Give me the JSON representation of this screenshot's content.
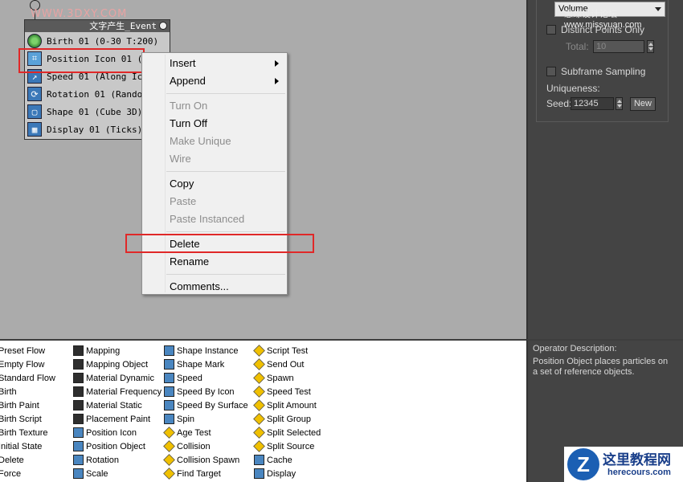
{
  "watermark_top": "WWW.3DXY.COM",
  "event": {
    "title": "文字产生_Event",
    "operators": [
      {
        "label": "Birth 01 (0-30 T:200)",
        "icon": "birth-icon"
      },
      {
        "label": "Position Icon 01 (Vo",
        "icon": "position-icon-icon"
      },
      {
        "label": "Speed 01 (Along Icon",
        "icon": "speed-icon"
      },
      {
        "label": "Rotation 01 (Random",
        "icon": "rotation-icon"
      },
      {
        "label": "Shape 01 (Cube 3D)",
        "icon": "shape-icon"
      },
      {
        "label": "Display 01 (Ticks)",
        "icon": "display-icon"
      }
    ]
  },
  "context_menu": {
    "groups": [
      [
        {
          "label": "Insert",
          "disabled": false,
          "submenu": true
        },
        {
          "label": "Append",
          "disabled": false,
          "submenu": true
        }
      ],
      [
        {
          "label": "Turn On",
          "disabled": true
        },
        {
          "label": "Turn Off",
          "disabled": false
        },
        {
          "label": "Make Unique",
          "disabled": true
        },
        {
          "label": "Wire",
          "disabled": true
        }
      ],
      [
        {
          "label": "Copy",
          "disabled": false
        },
        {
          "label": "Paste",
          "disabled": true
        },
        {
          "label": "Paste Instanced",
          "disabled": true
        }
      ],
      [
        {
          "label": "Delete",
          "disabled": false
        },
        {
          "label": "Rename",
          "disabled": false
        }
      ],
      [
        {
          "label": "Comments...",
          "disabled": false
        }
      ]
    ]
  },
  "right_panel": {
    "dropdown_value": "Volume",
    "watermark": "思缘设计论坛 www.missyuan.com",
    "distinct_points_only": "Distinct Points Only",
    "total_label": "Total:",
    "total_value": "10",
    "subframe_sampling": "Subframe Sampling",
    "uniqueness_label": "Uniqueness:",
    "seed_label": "Seed:",
    "seed_value": "12345",
    "new_button": "New"
  },
  "depot": {
    "columns": [
      [
        {
          "label": "Preset Flow",
          "icon": "none"
        },
        {
          "label": "Empty Flow",
          "icon": "none"
        },
        {
          "label": "Standard Flow",
          "icon": "none"
        },
        {
          "label": "Birth",
          "icon": "none"
        },
        {
          "label": "Birth Paint",
          "icon": "none"
        },
        {
          "label": "Birth Script",
          "icon": "none"
        },
        {
          "label": "Birth Texture",
          "icon": "none"
        },
        {
          "label": "Initial State",
          "icon": "none"
        },
        {
          "label": "Delete",
          "icon": "none"
        },
        {
          "label": "Force",
          "icon": "none"
        }
      ],
      [
        {
          "label": "Mapping",
          "icon": "dark"
        },
        {
          "label": "Mapping Object",
          "icon": "dark"
        },
        {
          "label": "Material Dynamic",
          "icon": "dark"
        },
        {
          "label": "Material Frequency",
          "icon": "dark"
        },
        {
          "label": "Material Static",
          "icon": "dark"
        },
        {
          "label": "Placement Paint",
          "icon": "dark"
        },
        {
          "label": "Position Icon",
          "icon": "blue"
        },
        {
          "label": "Position Object",
          "icon": "blue"
        },
        {
          "label": "Rotation",
          "icon": "blue"
        },
        {
          "label": "Scale",
          "icon": "blue"
        }
      ],
      [
        {
          "label": "Shape Instance",
          "icon": "blue"
        },
        {
          "label": "Shape Mark",
          "icon": "blue"
        },
        {
          "label": "Speed",
          "icon": "blue"
        },
        {
          "label": "Speed By Icon",
          "icon": "blue"
        },
        {
          "label": "Speed By Surface",
          "icon": "blue"
        },
        {
          "label": "Spin",
          "icon": "blue"
        },
        {
          "label": "Age Test",
          "icon": "diamond"
        },
        {
          "label": "Collision",
          "icon": "diamond"
        },
        {
          "label": "Collision Spawn",
          "icon": "diamond"
        },
        {
          "label": "Find Target",
          "icon": "diamond"
        }
      ],
      [
        {
          "label": "Script Test",
          "icon": "diamond"
        },
        {
          "label": "Send Out",
          "icon": "diamond"
        },
        {
          "label": "Spawn",
          "icon": "diamond"
        },
        {
          "label": "Speed Test",
          "icon": "diamond"
        },
        {
          "label": "Split Amount",
          "icon": "diamond"
        },
        {
          "label": "Split Group",
          "icon": "diamond"
        },
        {
          "label": "Split Selected",
          "icon": "diamond"
        },
        {
          "label": "Split Source",
          "icon": "diamond"
        },
        {
          "label": "Cache",
          "icon": "blue"
        },
        {
          "label": "Display",
          "icon": "blue"
        }
      ]
    ]
  },
  "description": {
    "title": "Operator Description:",
    "text": "Position Object places particles on a set of reference objects."
  },
  "corner_logo": {
    "mark": "Z",
    "title": "这里教程网",
    "url": "herecours.com"
  },
  "colors": {
    "highlight_red": "#e02828",
    "canvas_gray": "#ababab",
    "panel_dark": "#444444"
  }
}
